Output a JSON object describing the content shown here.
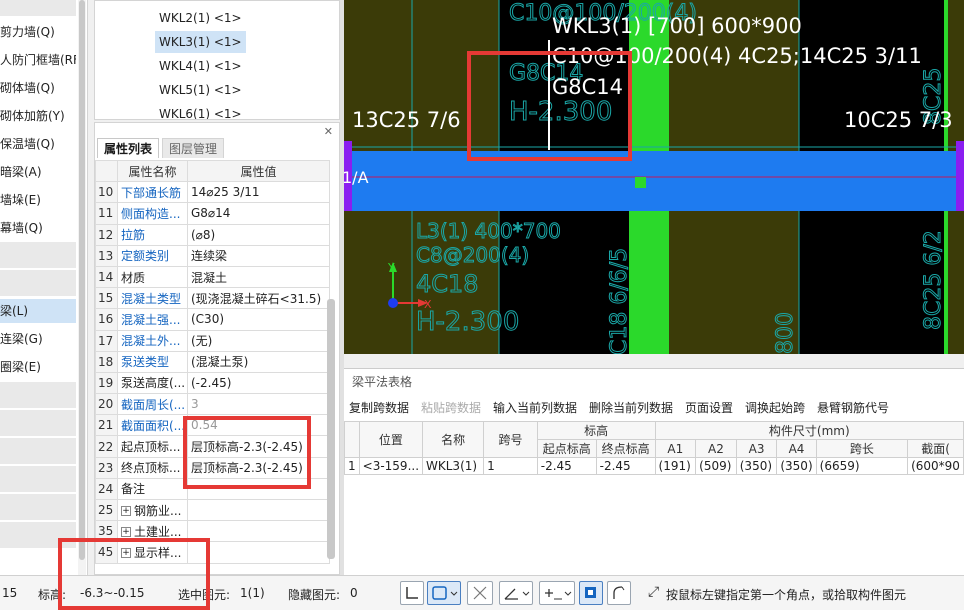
{
  "left_nav": {
    "items": [
      {
        "label": "剪力墙(Q)"
      },
      {
        "label": "人防门框墙(RF"
      },
      {
        "label": "砌体墙(Q)"
      },
      {
        "label": "砌体加筋(Y)"
      },
      {
        "label": "保温墙(Q)"
      },
      {
        "label": "暗梁(A)"
      },
      {
        "label": "墙垛(E)"
      },
      {
        "label": "幕墙(Q)"
      },
      {
        "label": "梁(L)"
      },
      {
        "label": "连梁(G)"
      },
      {
        "label": "圈梁(E)"
      }
    ],
    "selected_index": 8
  },
  "tree": {
    "items": [
      {
        "label": "WKL2(1) <1>"
      },
      {
        "label": "WKL3(1) <1>"
      },
      {
        "label": "WKL4(1) <1>"
      },
      {
        "label": "WKL5(1) <1>"
      },
      {
        "label": "WKL6(1) <1>"
      }
    ],
    "selected_index": 1
  },
  "props": {
    "tab_active": "属性列表",
    "tab_inactive": "图层管理",
    "close_glyph": "✕",
    "header_name": "属性名称",
    "header_value": "属性值",
    "rows": [
      {
        "num": "10",
        "name": "下部通长筋",
        "value": "14⌀25 3/11",
        "blue": true
      },
      {
        "num": "11",
        "name": "侧面构造...",
        "value": "G8⌀14",
        "blue": true
      },
      {
        "num": "12",
        "name": "拉筋",
        "value": "(⌀8)",
        "blue": true
      },
      {
        "num": "13",
        "name": "定额类别",
        "value": "连续梁",
        "blue": true
      },
      {
        "num": "14",
        "name": "材质",
        "value": "混凝土",
        "blue": false
      },
      {
        "num": "15",
        "name": "混凝土类型",
        "value": "(现浇混凝土碎石<31.5)",
        "blue": true
      },
      {
        "num": "16",
        "name": "混凝土强...",
        "value": "(C30)",
        "blue": true
      },
      {
        "num": "17",
        "name": "混凝土外...",
        "value": "(无)",
        "blue": true
      },
      {
        "num": "18",
        "name": "泵送类型",
        "value": "(混凝土泵)",
        "blue": true
      },
      {
        "num": "19",
        "name": "泵送高度(...",
        "value": "(-2.45)",
        "blue": false
      },
      {
        "num": "20",
        "name": "截面周长(...",
        "value": "3",
        "blue": true,
        "grey": true
      },
      {
        "num": "21",
        "name": "截面面积(...",
        "value": "0.54",
        "blue": true,
        "grey": true
      },
      {
        "num": "22",
        "name": "起点顶标...",
        "value": "层顶标高-2.3(-2.45)",
        "blue": false
      },
      {
        "num": "23",
        "name": "终点顶标...",
        "value": "层顶标高-2.3(-2.45)",
        "blue": false
      },
      {
        "num": "24",
        "name": "备注",
        "value": "",
        "blue": false
      },
      {
        "num": "25",
        "name": "钢筋业...",
        "value": "",
        "blue": false,
        "expand": true
      },
      {
        "num": "35",
        "name": "土建业...",
        "value": "",
        "blue": false,
        "expand": true
      },
      {
        "num": "45",
        "name": "显示样...",
        "value": "",
        "blue": false,
        "expand": true
      }
    ]
  },
  "canvas": {
    "colors": {
      "bg": "#000000",
      "olive": "#3b3b08",
      "green": "#2bd92b",
      "blue": "#1e7bf0",
      "purple": "#8a1ef0",
      "cyan": "#1aa7a7",
      "white": "#ffffff"
    },
    "annotation_main": [
      "WKL3(1) [700] 600*900",
      "C10@100/200(4) 4C25;14C25 3/11",
      "G8C14"
    ],
    "left_bottom_rebar": "13C25 7/6",
    "right_bottom_rebar": "10C25 7/3",
    "axis_label": "1/A",
    "bg_texts": [
      "C10@100/200(4)",
      "G8C14",
      "H-2.300",
      "L3(1) 400*700",
      "C8@200(4)",
      "4C18",
      "H-2.300",
      "C18 6/6/5",
      "8C25",
      "8C25 6/2",
      "800"
    ],
    "ucs_y": "Y",
    "ucs_x": "X"
  },
  "grid_panel": {
    "title": "梁平法表格",
    "toolbar": [
      {
        "label": "复制跨数据",
        "enabled": true
      },
      {
        "label": "粘贴跨数据",
        "enabled": false
      },
      {
        "label": "输入当前列数据",
        "enabled": true
      },
      {
        "label": "删除当前列数据",
        "enabled": true
      },
      {
        "label": "页面设置",
        "enabled": true
      },
      {
        "label": "调换起始跨",
        "enabled": true
      },
      {
        "label": "悬臂钢筋代号",
        "enabled": true
      }
    ],
    "header_top": {
      "position": "位置",
      "name": "名称",
      "span": "跨号",
      "elevation": "标高",
      "size": "构件尺寸(mm)"
    },
    "header_sub": {
      "start_elev": "起点标高",
      "end_elev": "终点标高",
      "a1": "A1",
      "a2": "A2",
      "a3": "A3",
      "a4": "A4",
      "span_len": "跨长",
      "section": "截面("
    },
    "rows": [
      {
        "idx": "1",
        "position": "<3-159...",
        "name": "WKL3(1)",
        "span": "1",
        "start_elev": "-2.45",
        "end_elev": "-2.45",
        "a1": "(191)",
        "a2": "(509)",
        "a3": "(350)",
        "a4": "(350)",
        "span_len": "(6659)",
        "section": "(600*90"
      }
    ]
  },
  "status_bar": {
    "left_value": "15",
    "elevation_label": "标高:",
    "elevation_value": "-6.3~-0.15",
    "selected_label": "选中图元:",
    "selected_value": "1(1)",
    "hidden_label": "隐藏图元:",
    "hidden_value": "0",
    "hint": "按鼠标左键指定第一个角点，或拾取构件图元"
  }
}
